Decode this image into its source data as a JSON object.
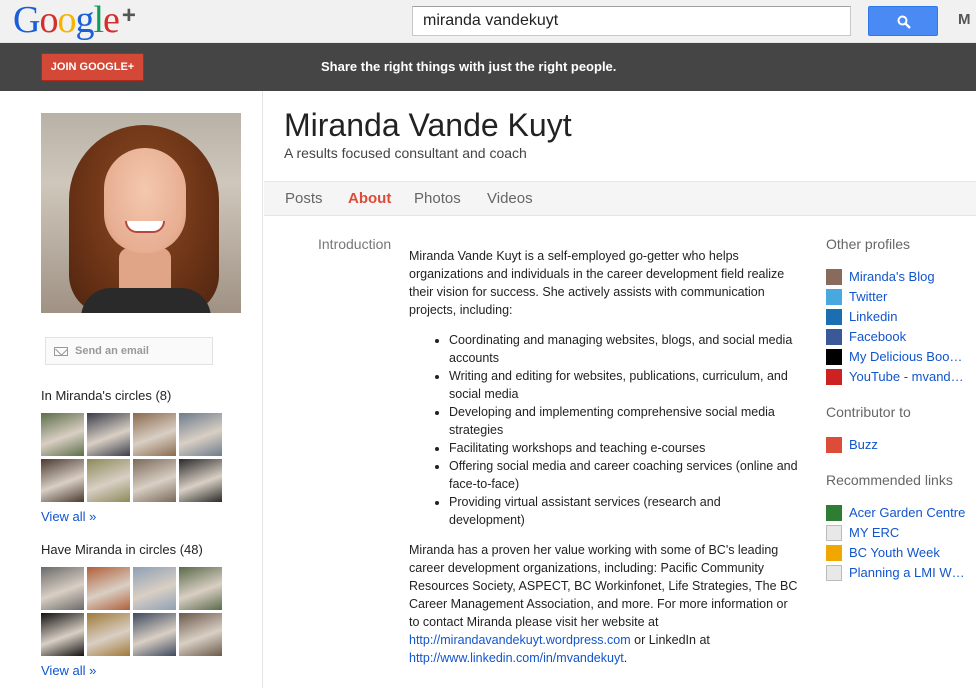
{
  "header": {
    "logo_letters": [
      "G",
      "o",
      "o",
      "g",
      "l",
      "e"
    ],
    "logo_plus": "+",
    "search_value": "miranda vandekuyt",
    "cut_text": "M"
  },
  "promo": {
    "join_label": "JOIN GOOGLE+",
    "message": "Share the right things with just the right people."
  },
  "profile": {
    "name": "Miranda Vande Kuyt",
    "tagline": "A results focused consultant and coach"
  },
  "tabs": [
    {
      "label": "Posts",
      "active": false
    },
    {
      "label": "About",
      "active": true
    },
    {
      "label": "Photos",
      "active": false
    },
    {
      "label": "Videos",
      "active": false
    }
  ],
  "sidebar": {
    "email_label": "Send an email",
    "in_circles_heading": "In Miranda's circles (8)",
    "have_circles_heading": "Have Miranda in circles (48)",
    "view_all": "View all »",
    "in_circles_avatars": [
      "#5b6e48",
      "#3a3d4a",
      "#8a6a4e",
      "#6d7c8c",
      "#4a3a30",
      "#8c8a5a",
      "#7a6a5a",
      "#2a2a2a"
    ],
    "have_circles_avatars": [
      "#6a6a6a",
      "#b0603a",
      "#8ea0b4",
      "#5a6a4a",
      "#111111",
      "#a07a3a",
      "#3e4a5e",
      "#6a5a4a"
    ]
  },
  "introduction": {
    "label": "Introduction",
    "paragraph1": "Miranda Vande Kuyt is a self-employed go-getter who helps organizations and individuals in the career development field realize their vision for success. She actively assists with communication projects, including:",
    "bullets": [
      "Coordinating and managing websites, blogs, and social media accounts",
      "Writing and editing for websites, publications, curriculum, and social media",
      "Developing and implementing comprehensive social media strategies",
      "Facilitating workshops and teaching e-courses",
      "Offering social media and career coaching services (online and face-to-face)",
      "Providing virtual assistant services (research and development)"
    ],
    "paragraph2": "Miranda has a proven her value working with some of BC's leading career development organizations, including: Pacific Community Resources Society, ASPECT, BC Workinfonet, Life Strategies, The BC Career Management Association, and more. For more information or to contact Miranda please visit her website at",
    "website_link": "http://mirandavandekuyt.wordpress.com",
    "or_linkedin": "or LinkedIn at",
    "linkedin_link": "http://www.linkedin.com/in/mvandekuyt",
    "end_period": "."
  },
  "other_profiles": {
    "heading": "Other profiles",
    "items": [
      {
        "label": "Miranda's Blog",
        "icon": "blog-icon",
        "color": "#8a6a5a"
      },
      {
        "label": "Twitter",
        "icon": "twitter-icon",
        "color": "#4aa8e0"
      },
      {
        "label": "Linkedin",
        "icon": "linkedin-icon",
        "color": "#1b6fb0"
      },
      {
        "label": "Facebook",
        "icon": "facebook-icon",
        "color": "#3b5998"
      },
      {
        "label": "My Delicious Boo…",
        "icon": "delicious-icon",
        "color": "#000000"
      },
      {
        "label": "YouTube - mvand…",
        "icon": "youtube-icon",
        "color": "#cc2222"
      }
    ]
  },
  "contributor_to": {
    "heading": "Contributor to",
    "items": [
      {
        "label": "Buzz",
        "icon": "google-buzz-icon",
        "color": "#dd4b39"
      }
    ]
  },
  "recommended_links": {
    "heading": "Recommended links",
    "items": [
      {
        "label": "Acer Garden Centre",
        "icon": "acer-garden-icon",
        "color": "#2e7d32"
      },
      {
        "label": "MY ERC",
        "icon": "page-icon",
        "color": "#e8e8e8"
      },
      {
        "label": "BC Youth Week",
        "icon": "youth-week-icon",
        "color": "#f0a800"
      },
      {
        "label": "Planning a LMI W…",
        "icon": "page-icon",
        "color": "#e8e8e8"
      }
    ]
  },
  "colors": {
    "google_blue": "#1a5fd6",
    "google_red": "#d32f2f",
    "google_yellow": "#f4b400",
    "google_green": "#0f9d58",
    "accent_red": "#dd4b39",
    "link_blue": "#1155cc"
  }
}
